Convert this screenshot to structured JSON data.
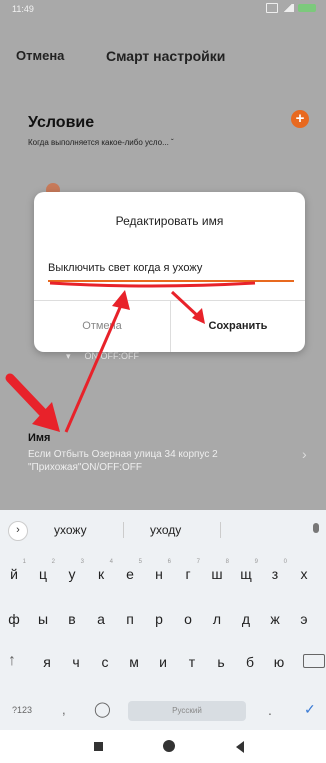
{
  "status_bar": {
    "time": "11:49"
  },
  "header": {
    "cancel_label": "Отмена",
    "title": "Смарт настройки"
  },
  "condition": {
    "title": "Условие",
    "description": "Когда выполняется какое-либо усло...",
    "dropdown_icon": "chevron-down-icon"
  },
  "action_state": "ON/OFF:OFF",
  "name_section": {
    "title": "Имя",
    "description": "Если Отбыть Озерная улица 34 корпус 2 \"Прихожая\"ON/OFF:OFF"
  },
  "dialog": {
    "title": "Редактировать имя",
    "input_value": "Выключить свет когда я ухожу",
    "cancel_label": "Отмена",
    "save_label": "Сохранить"
  },
  "keyboard": {
    "suggestions": [
      "ухожу",
      "уходу"
    ],
    "row1": [
      "й",
      "ц",
      "у",
      "к",
      "е",
      "н",
      "г",
      "ш",
      "щ",
      "з",
      "х"
    ],
    "row1_hints": [
      "1",
      "2",
      "3",
      "4",
      "5",
      "6",
      "7",
      "8",
      "9",
      "0",
      ""
    ],
    "row2": [
      "ф",
      "ы",
      "в",
      "а",
      "п",
      "р",
      "о",
      "л",
      "д",
      "ж",
      "э"
    ],
    "row3": [
      "я",
      "ч",
      "с",
      "м",
      "и",
      "т",
      "ь",
      "б",
      "ю"
    ],
    "num_label": "?123",
    "comma": ",",
    "space_label": "Русский",
    "period": "."
  },
  "colors": {
    "accent": "#e8691f",
    "annotation": "#e8222a",
    "dim_background": "#a9a9a9"
  }
}
